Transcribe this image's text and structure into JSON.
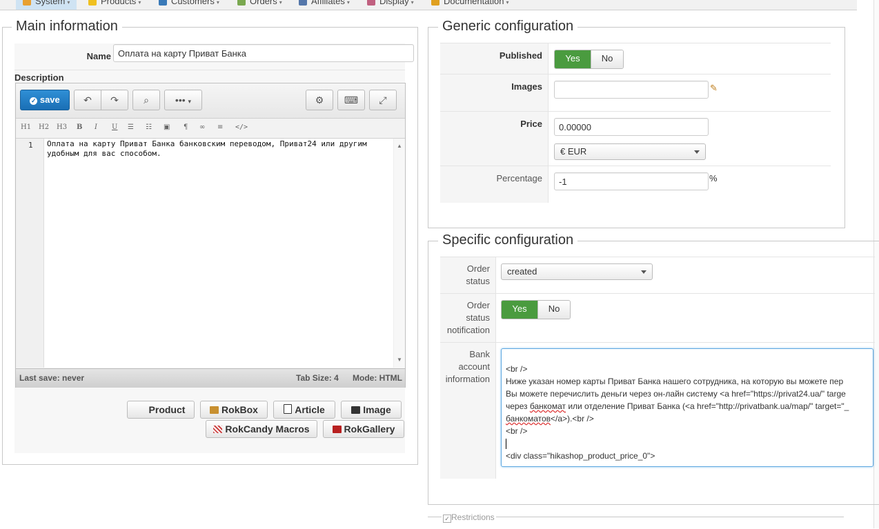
{
  "topnav": {
    "items": [
      {
        "label": "System",
        "active": true
      },
      {
        "label": "Products"
      },
      {
        "label": "Customers"
      },
      {
        "label": "Orders"
      },
      {
        "label": "Affiliates"
      },
      {
        "label": "Display"
      },
      {
        "label": "Documentation"
      }
    ]
  },
  "main": {
    "legend": "Main information",
    "name_label": "Name",
    "name_value": "Оплата на карту Приват Банка",
    "description_label": "Description",
    "editor": {
      "save_label": "save",
      "format_buttons": [
        "H1",
        "H2",
        "H3",
        "B",
        "I",
        "U",
        "ol",
        "ul",
        "img",
        "¶",
        "link",
        "hr",
        "</>"
      ],
      "line_number": "1",
      "content": "Оплата на карту Приват Банка банковским переводом, Приват24 или другим удобным для вас способом.",
      "status_left": "Last save: never",
      "tab_size": "Tab Size: 4",
      "mode": "Mode: HTML"
    },
    "plugin_buttons": {
      "product": "Product",
      "rokbox": "RokBox",
      "article": "Article",
      "image": "Image",
      "rokcandy": "RokCandy Macros",
      "rokgallery": "RokGallery"
    }
  },
  "generic": {
    "legend": "Generic configuration",
    "published_label": "Published",
    "yes": "Yes",
    "no": "No",
    "images_label": "Images",
    "images_value": "",
    "price_label": "Price",
    "price_value": "0.00000",
    "currency": "€ EUR",
    "percentage_label": "Percentage",
    "percentage_value": "-1",
    "percent_sign": "%"
  },
  "specific": {
    "legend": "Specific configuration",
    "order_status_label_1": "Order",
    "order_status_label_2": "status",
    "order_status_value": "created",
    "notification_label_1": "Order",
    "notification_label_2": "status",
    "notification_label_3": "notification",
    "yes": "Yes",
    "no": "No",
    "bank_label_1": "Bank",
    "bank_label_2": "account",
    "bank_label_3": "information",
    "bank_lines": {
      "l1": "<br />",
      "l2": "Ниже указан номер карты Приват Банка нашего сотрудника, на которую вы можете пер",
      "l3": "Вы можете перечислить деньги через он-лайн систему <a href=\"https://privat24.ua/\" targe",
      "l4a": "через ",
      "l4b": "банкомат",
      "l4c": " или отделение Приват Банка (<a href=\"http://privatbank.ua/map/\" target=\"_",
      "l5a": "банкоматов",
      "l5b": "</a>).<br />",
      "l6": "<br />",
      "l7": "",
      "l8": "<div class=\"hikashop_product_price_0\">"
    }
  },
  "restrictions": {
    "label": "Restrictions"
  },
  "colors": {
    "accent_blue": "#1a6fb5",
    "toggle_green": "#4a9b3f"
  }
}
